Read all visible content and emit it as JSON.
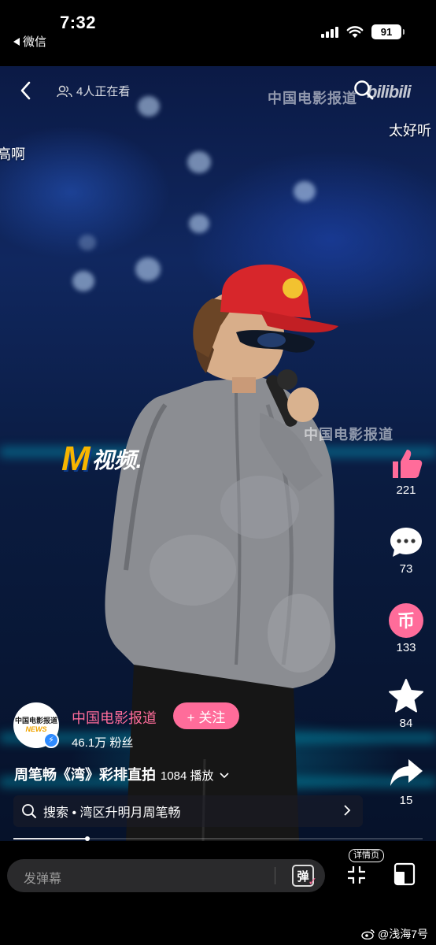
{
  "status_bar": {
    "time": "7:32",
    "back_app": "微信",
    "battery": "91"
  },
  "video_header": {
    "viewers": "4人正在看",
    "watermark_top": "中国电影报道",
    "platform_logo": "bilibili"
  },
  "danmu": [
    "太好听",
    "高啊"
  ],
  "overlay": {
    "watermark_mid": "中国电影报道",
    "m_logo_letter": "M",
    "m_logo_text": "视频."
  },
  "actions": {
    "like_count": "221",
    "comment_count": "73",
    "coin_label": "币",
    "coin_count": "133",
    "favorite_count": "84",
    "share_count": "15"
  },
  "channel": {
    "avatar_text": "中国电影报道",
    "avatar_news": "NEWS",
    "name": "中国电影报道",
    "follow_label": "+ 关注",
    "fans": "46.1万 粉丝"
  },
  "video_info": {
    "title": "周笔畅《湾》彩排直拍",
    "plays": "1084 播放"
  },
  "search": {
    "label": "搜索 • 湾区升明月周笔畅"
  },
  "progress": 0.18,
  "bottom_bar": {
    "danmu_placeholder": "发弹幕",
    "danmu_toggle": "弹",
    "detail_label": "详情页",
    "credit": "@浅海7号"
  },
  "colors": {
    "accent_pink": "#ff6c9a",
    "logo_yellow": "#f7b500",
    "verify_blue": "#2e8bff"
  },
  "icons": [
    "back-icon",
    "viewers-icon",
    "search-icon",
    "like-icon",
    "comment-icon",
    "coin-icon",
    "star-icon",
    "share-icon",
    "chevron-right-icon",
    "exit-fullscreen-icon",
    "detail-page-icon",
    "weibo-icon"
  ]
}
